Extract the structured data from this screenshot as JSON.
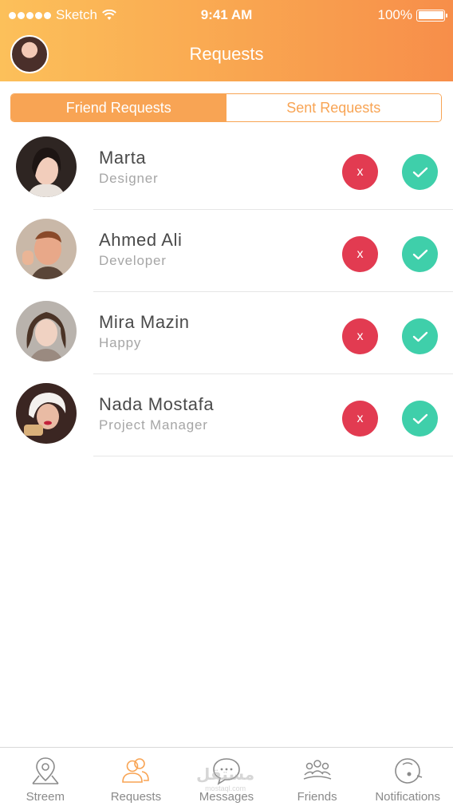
{
  "status_bar": {
    "carrier": "Sketch",
    "time": "9:41 AM",
    "battery": "100%",
    "battery_level": 1.0
  },
  "header": {
    "title": "Requests"
  },
  "segments": {
    "active": "Friend Requests",
    "inactive": "Sent Requests"
  },
  "requests": [
    {
      "name": "Marta",
      "role": "Designer"
    },
    {
      "name": "Ahmed Ali",
      "role": "Developer"
    },
    {
      "name": "Mira Mazin",
      "role": "Happy"
    },
    {
      "name": "Nada Mostafa",
      "role": "Project Manager"
    }
  ],
  "actions": {
    "reject_label": "x"
  },
  "tabs": [
    {
      "label": "Streem",
      "icon": "map-pin-icon"
    },
    {
      "label": "Requests",
      "icon": "people-icon"
    },
    {
      "label": "Messages",
      "icon": "chat-bubble-icon"
    },
    {
      "label": "Friends",
      "icon": "group-icon"
    },
    {
      "label": "Notifications",
      "icon": "bell-icon"
    }
  ],
  "colors": {
    "accent": "#f8a454",
    "reject": "#e23b51",
    "accept": "#3fcfaa"
  },
  "watermark": {
    "text": "مستقل",
    "sub": "mostaql.com"
  }
}
